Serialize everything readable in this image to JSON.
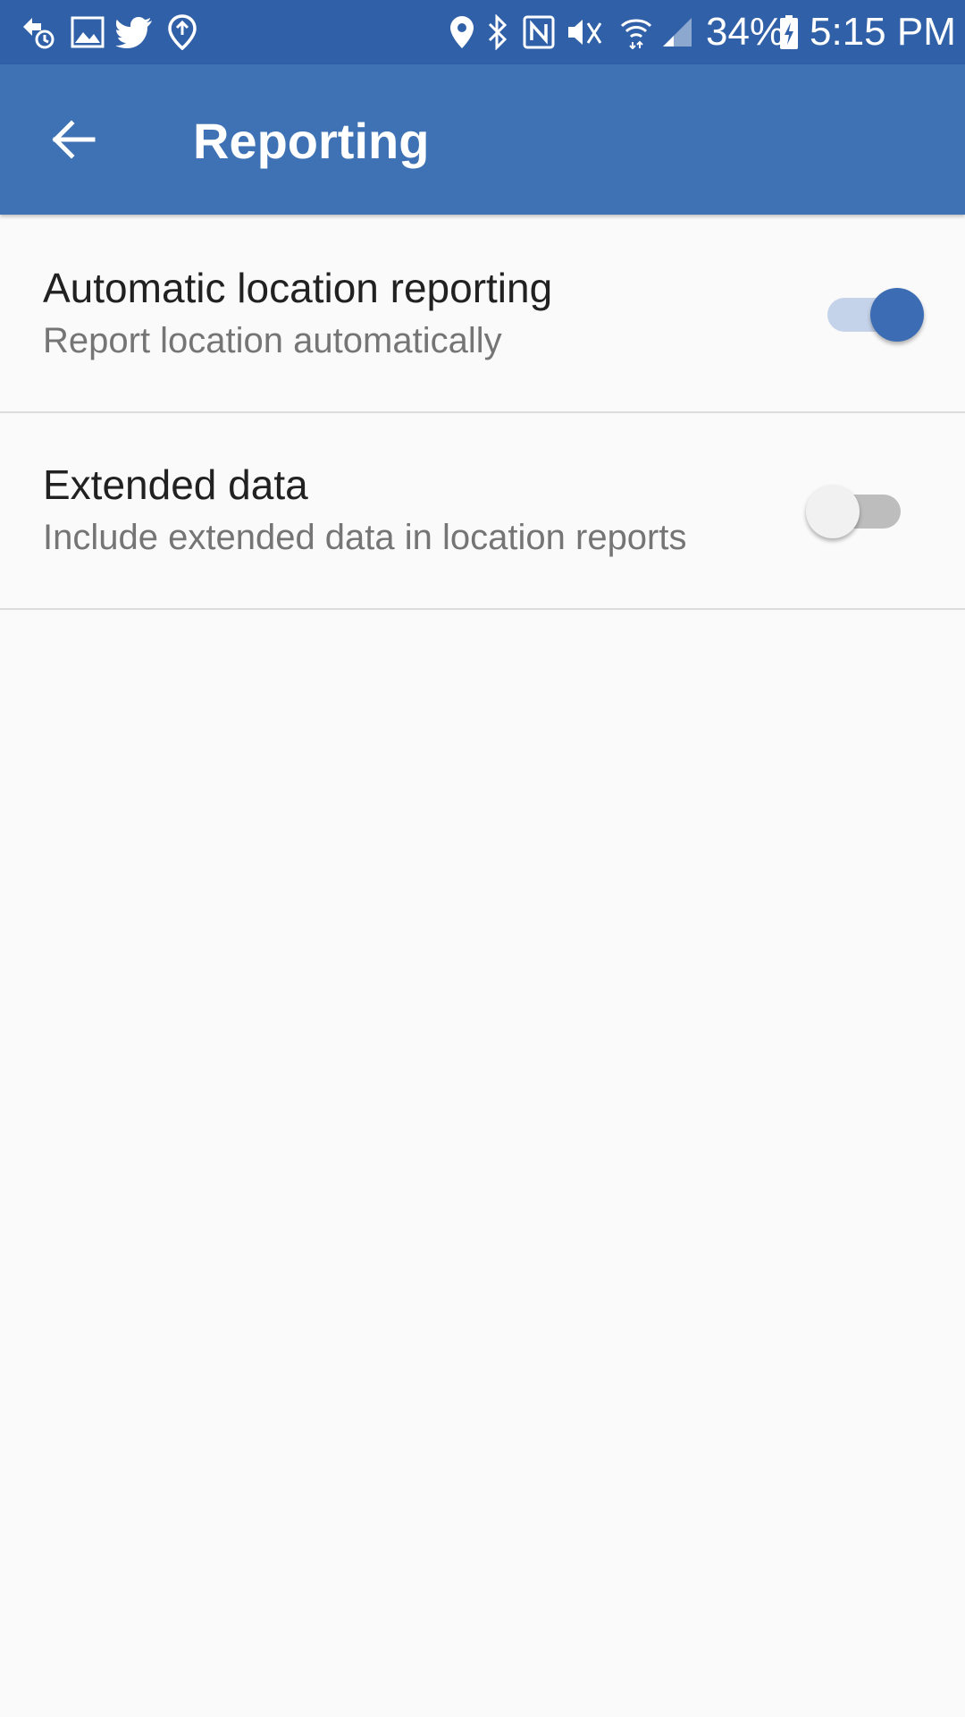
{
  "status_bar": {
    "notification_icons": [
      "sync-icon",
      "image-icon",
      "twitter-icon",
      "location-pin-icon"
    ],
    "system_icons": [
      "location-icon",
      "bluetooth-icon",
      "nfc-icon",
      "mute-icon",
      "wifi-icon",
      "signal-icon",
      "battery-charging-icon"
    ],
    "battery": "34%",
    "time": "5:15 PM"
  },
  "app_bar": {
    "back_icon": "arrow-back-icon",
    "title": "Reporting"
  },
  "settings": [
    {
      "title": "Automatic location reporting",
      "summary": "Report location automatically",
      "enabled": true
    },
    {
      "title": "Extended data",
      "summary": "Include extended data in location reports",
      "enabled": false
    }
  ],
  "colors": {
    "status_bar": "#3061a8",
    "app_bar": "#3f72b5",
    "accent": "#3b6cb4",
    "background": "#fafafa"
  }
}
